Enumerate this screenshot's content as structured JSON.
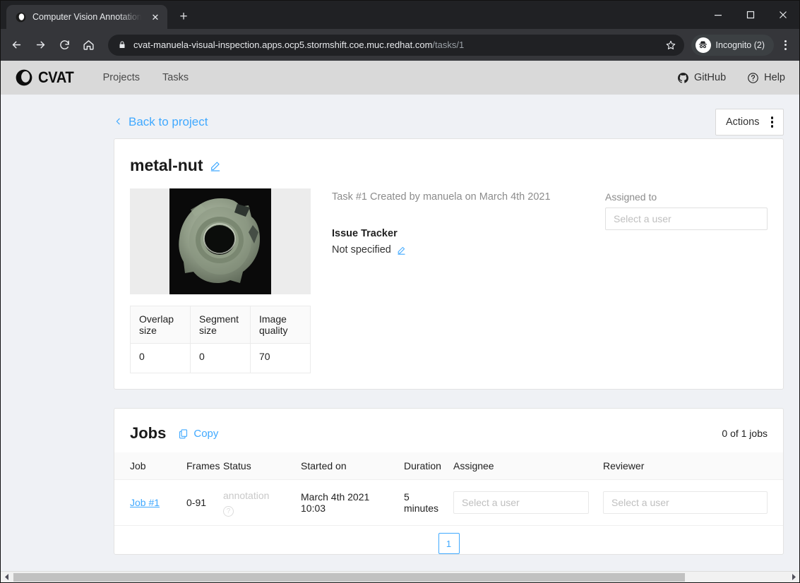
{
  "browser": {
    "tab": {
      "title": "Computer Vision Annotation T",
      "favicon": "cvat-favicon",
      "close": "✕"
    },
    "newtab_label": "+",
    "window_controls": {
      "minimize": "—",
      "maximize": "☐",
      "close": "✕"
    },
    "nav": {
      "back": "←",
      "forward": "→",
      "reload": "↻",
      "home": "⌂"
    },
    "omnibox": {
      "lock_icon": "lock-icon",
      "url_host": "cvat-manuela-visual-inspection.apps.ocp5.stormshift.coe.muc.redhat.com",
      "url_path": "/tasks/1",
      "star_icon": "☆"
    },
    "profile": {
      "label": "Incognito (2)",
      "icon": "incognito-icon"
    },
    "menu_icon": "kebab-menu-icon"
  },
  "app_header": {
    "logo_text": "CVAT",
    "nav_items": [
      {
        "label": "Projects"
      },
      {
        "label": "Tasks"
      }
    ],
    "right_items": [
      {
        "label": "GitHub",
        "icon": "github-icon"
      },
      {
        "label": "Help",
        "icon": "question-circle-icon"
      }
    ]
  },
  "topbar": {
    "back_label": "Back to project",
    "actions_label": "Actions"
  },
  "task": {
    "name": "metal-nut",
    "edit_icon": "pencil-icon",
    "created_line": "Task #1 Created by manuela on March 4th 2021",
    "issue_tracker_label": "Issue Tracker",
    "issue_tracker_value": "Not specified",
    "assigned_to_label": "Assigned to",
    "assignee_placeholder": "Select a user",
    "params": {
      "headers": [
        "Overlap size",
        "Segment size",
        "Image quality"
      ],
      "values": [
        "0",
        "0",
        "70"
      ]
    }
  },
  "jobs": {
    "title": "Jobs",
    "copy_label": "Copy",
    "copy_icon": "copy-icon",
    "count_label": "0 of 1 jobs",
    "columns": [
      "Job",
      "Frames",
      "Status",
      "Started on",
      "Duration",
      "Assignee",
      "Reviewer"
    ],
    "rows": [
      {
        "job": "Job #1",
        "frames": "0-91",
        "status": "annotation",
        "status_icon": "question-circle-icon",
        "started_on": "March 4th 2021 10:03",
        "duration": "5 minutes",
        "assignee_placeholder": "Select a user",
        "reviewer_placeholder": "Select a user"
      }
    ],
    "pagination": {
      "current_page": "1"
    }
  },
  "colors": {
    "link_blue": "#40a9ff",
    "page_bg": "#eff1f5",
    "header_bg": "#d9d9d9",
    "chrome_bg": "#202124",
    "toolbar_bg": "#35363a"
  }
}
